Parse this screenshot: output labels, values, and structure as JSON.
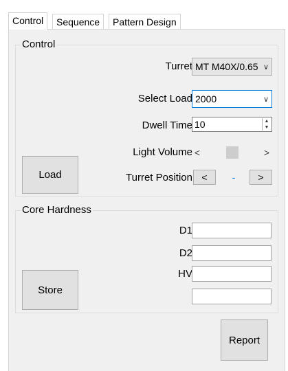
{
  "tabs": [
    {
      "label": "Control",
      "active": true
    },
    {
      "label": "Sequence",
      "active": false
    },
    {
      "label": "Pattern Design",
      "active": false
    }
  ],
  "control_group": {
    "title": "Control",
    "turret_label": "Turret",
    "turret_value": "MT M40X/0.65",
    "select_load_label": "Select Load",
    "select_load_value": "2000",
    "dwell_time_label": "Dwell Time",
    "dwell_time_value": "10",
    "light_volume_label": "Light Volume",
    "light_volume_left": "<",
    "light_volume_right": ">",
    "light_volume_level": 0.5,
    "load_button": "Load",
    "turret_position_label": "Turret Position",
    "turret_prev": "<",
    "turret_position_value": "-",
    "turret_next": ">"
  },
  "core_hardness_group": {
    "title": "Core Hardness",
    "d1_label": "D1",
    "d1_value": "",
    "d2_label": "D2",
    "d2_value": "",
    "hv_label": "HV",
    "hv_value": "",
    "extra_value": "",
    "store_button": "Store"
  },
  "report_button": "Report",
  "colors": {
    "panel_bg": "#f0f0f0",
    "focus_border": "#0078d7",
    "position_value": "#0078d7"
  }
}
